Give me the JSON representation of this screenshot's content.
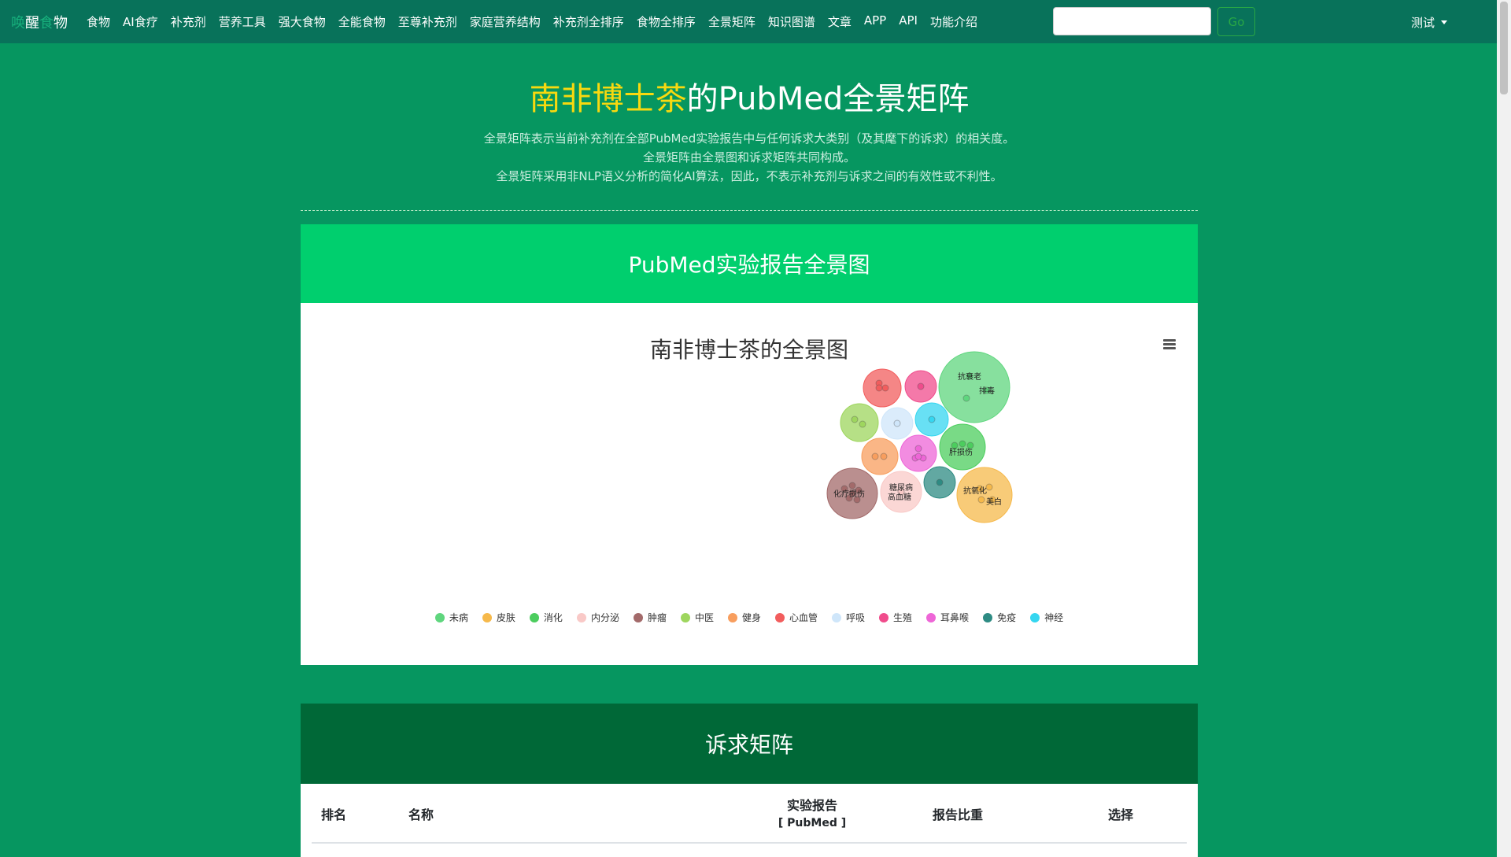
{
  "navbar": {
    "brand": [
      "唤",
      "醒",
      "食",
      "物"
    ],
    "links": [
      "食物",
      "AI食疗",
      "补充剂",
      "营养工具",
      "强大食物",
      "全能食物",
      "至尊补充剂",
      "家庭营养结构",
      "补充剂全排序",
      "食物全排序",
      "全景矩阵",
      "知识图谱",
      "文章",
      "APP",
      "API",
      "功能介绍"
    ],
    "search_placeholder": "",
    "go_label": "Go",
    "user_label": "测试"
  },
  "hero": {
    "title_highlight": "南非博士茶",
    "title_rest": "的PubMed全景矩阵",
    "desc_lines": [
      "全景矩阵表示当前补充剂在全部PubMed实验报告中与任何诉求大类别（及其麾下的诉求）的相关度。",
      "全景矩阵由全景图和诉求矩阵共同构成。",
      "全景矩阵采用非NLP语义分析的简化AI算法，因此，不表示补充剂与诉求之间的有效性或不利性。"
    ]
  },
  "overview": {
    "header": "PubMed实验报告全景图",
    "chart_title": "南非博士茶的全景图"
  },
  "chart_data": {
    "type": "packed-bubble",
    "title": "南非博士茶的全景图",
    "legend_position": "bottom",
    "series": [
      {
        "name": "未病",
        "color": "#5fd67e",
        "labels": [
          "抗衰老",
          "排毒"
        ]
      },
      {
        "name": "皮肤",
        "color": "#f6b94b",
        "labels": [
          "抗氧化",
          "美白"
        ]
      },
      {
        "name": "消化",
        "color": "#4ccd5e",
        "labels": [
          "肝损伤"
        ]
      },
      {
        "name": "内分泌",
        "color": "#f9c9c7",
        "labels": [
          "糖尿病",
          "高血糖"
        ]
      },
      {
        "name": "肿瘤",
        "color": "#a36a6a",
        "labels": [
          "化疗损伤"
        ]
      },
      {
        "name": "中医",
        "color": "#9ed65e",
        "labels": []
      },
      {
        "name": "健身",
        "color": "#f89e5e",
        "labels": []
      },
      {
        "name": "心血管",
        "color": "#f25d5d",
        "labels": []
      },
      {
        "name": "呼吸",
        "color": "#cfe6fa",
        "labels": []
      },
      {
        "name": "生殖",
        "color": "#f04c8c",
        "labels": []
      },
      {
        "name": "耳鼻喉",
        "color": "#ee66d7",
        "labels": []
      },
      {
        "name": "免疫",
        "color": "#2e8b83",
        "labels": []
      },
      {
        "name": "神经",
        "color": "#35d6f0",
        "labels": []
      }
    ]
  },
  "matrix": {
    "header": "诉求矩阵",
    "columns": [
      "排名",
      "名称",
      "实验报告",
      "[ PubMed ]",
      "报告比重",
      "选择"
    ]
  },
  "colors": {
    "page_bg": "#069660",
    "navbar_bg": "#08725a",
    "overview_header_bg": "#00cf6e",
    "matrix_header_bg": "#006837",
    "title_highlight": "#f8d90f"
  }
}
